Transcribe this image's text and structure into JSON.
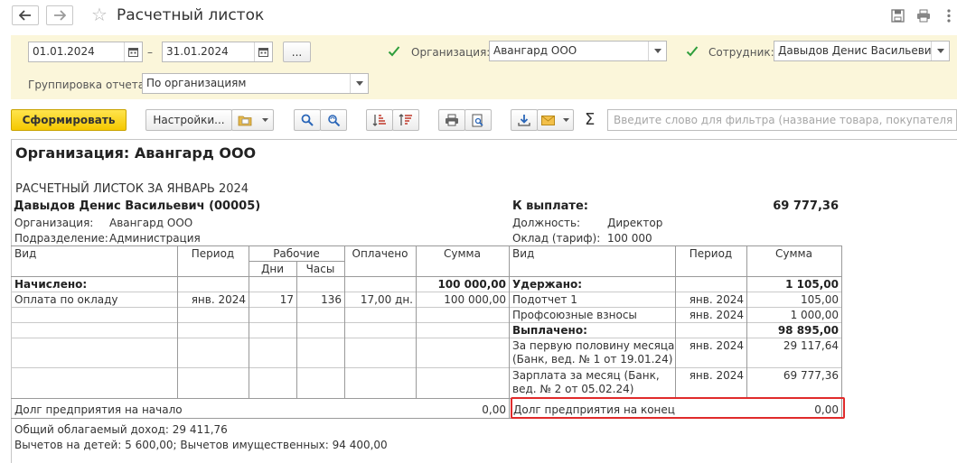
{
  "window": {
    "title": "Расчетный листок",
    "back_icon": "arrow-left-icon",
    "forward_icon": "arrow-right-icon",
    "favorite_icon": "star-icon",
    "actions": [
      "save-icon",
      "print-icon",
      "more-icon"
    ]
  },
  "params": {
    "date_from": "01.01.2024",
    "dash": "–",
    "date_to": "31.01.2024",
    "ellipsis_label": "...",
    "org_checked": true,
    "org_label": "Организация:",
    "org_value": "Авангард ООО",
    "emp_checked": true,
    "emp_label": "Сотрудник:",
    "emp_value": "Давыдов Денис Васильевич",
    "group_label": "Группировка отчета:",
    "group_value": "По организациям"
  },
  "toolbar": {
    "generate_label": "Сформировать",
    "settings_label": "Настройки...",
    "sum_symbol": "Σ",
    "search_placeholder": "Введите слово для фильтра (название товара, покупателя и пр.)"
  },
  "report": {
    "org_header": "Организация: Авангард ООО",
    "title": "РАСЧЕТНЫЙ ЛИСТОК ЗА ЯНВАРЬ 2024",
    "employee": "Давыдов Денис Васильевич (00005)",
    "org_label": "Организация:",
    "org_value": "Авангард ООО",
    "dept_label": "Подразделение:",
    "dept_value": "Администрация",
    "to_pay_label": "К выплате:",
    "to_pay_value": "69 777,36",
    "position_label": "Должность:",
    "position_value": "Директор",
    "salary_label": "Оклад (тариф):",
    "salary_value": "100 000",
    "left_headers": {
      "kind": "Вид",
      "period": "Период",
      "working": "Рабочие",
      "days": "Дни",
      "hours": "Часы",
      "paid": "Оплачено",
      "sum": "Сумма"
    },
    "right_headers": {
      "kind": "Вид",
      "period": "Период",
      "sum": "Сумма"
    },
    "accrued_label": "Начислено:",
    "accrued_total": "100 000,00",
    "accrual": {
      "name": "Оплата по окладу",
      "period": "янв. 2024",
      "days": "17",
      "hours": "136",
      "paid": "17,00 дн.",
      "sum": "100 000,00"
    },
    "withheld_label": "Удержано:",
    "withheld_total": "1 105,00",
    "withholdings": [
      {
        "name": "Подотчет 1",
        "period": "янв. 2024",
        "sum": "105,00"
      },
      {
        "name": "Профсоюзные взносы",
        "period": "янв. 2024",
        "sum": "1 000,00"
      }
    ],
    "paid_label": "Выплачено:",
    "paid_total": "98 895,00",
    "payments": [
      {
        "line1": "За первую половину месяца",
        "line2": "(Банк, вед. № 1 от 19.01.24)",
        "period": "янв. 2024",
        "sum": "29 117,64"
      },
      {
        "line1": "Зарплата за месяц (Банк,",
        "line2": "вед. № 2 от 05.02.24)",
        "period": "янв. 2024",
        "sum": "69 777,36"
      }
    ],
    "debt_start_label": "Долг предприятия на начало",
    "debt_start_value": "0,00",
    "debt_end_label": "Долг предприятия на конец",
    "debt_end_value": "0,00",
    "taxable_income": "Общий облагаемый доход: 29 411,76",
    "deductions": "Вычетов на детей: 5 600,00; Вычетов имущественных: 94 400,00"
  }
}
